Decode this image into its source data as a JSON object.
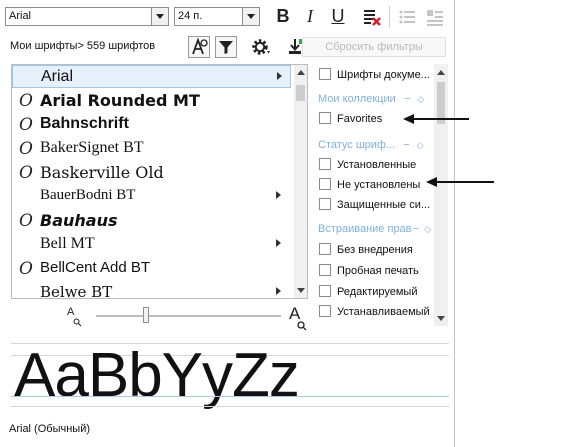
{
  "toolbar": {
    "font_name": "Arial",
    "font_size": "24 п.",
    "bold_label": "B",
    "italic_label": "I",
    "underline_label": "U",
    "icons": [
      "text-color-x-icon",
      "bullet-list-icon",
      "numbered-list-icon"
    ]
  },
  "header": {
    "collection_label": "Мои шрифты> 559 шрифтов",
    "reset_filters": "Сбросить фильтры",
    "icons": [
      "font-playground-icon",
      "filter-icon",
      "gear-icon",
      "download-font-icon"
    ]
  },
  "font_list": {
    "items": [
      {
        "name": "Arial",
        "selected": true,
        "opentype": false,
        "has_submenu": true
      },
      {
        "name": "Arial Rounded MT",
        "selected": false,
        "opentype": true,
        "has_submenu": false
      },
      {
        "name": "Bahnschrift",
        "selected": false,
        "opentype": true,
        "has_submenu": false
      },
      {
        "name": "BakerSignet BT",
        "selected": false,
        "opentype": true,
        "has_submenu": false
      },
      {
        "name": "Baskerville Old",
        "selected": false,
        "opentype": true,
        "has_submenu": false
      },
      {
        "name": "BauerBodni BT",
        "selected": false,
        "opentype": false,
        "has_submenu": true
      },
      {
        "name": "Bauhaus",
        "selected": false,
        "opentype": true,
        "has_submenu": false
      },
      {
        "name": "Bell MT",
        "selected": false,
        "opentype": false,
        "has_submenu": true
      },
      {
        "name": "BellCent Add BT",
        "selected": false,
        "opentype": true,
        "has_submenu": false
      },
      {
        "name": "Belwe BT",
        "selected": false,
        "opentype": false,
        "has_submenu": true
      }
    ]
  },
  "zoom": {
    "small_label": "A",
    "large_label": "A",
    "level": 0.27
  },
  "filters": {
    "top_item": "Шрифты докуме...",
    "my_collections": {
      "heading": "Мои коллекции",
      "items": [
        "Favorites"
      ]
    },
    "font_status": {
      "heading": "Статус шриф...",
      "items": [
        "Установленные",
        "Не установлены",
        "Защищенные си..."
      ]
    },
    "embedding": {
      "heading": "Встраивание прав",
      "items": [
        "Без внедрения",
        "Пробная печать",
        "Редактируемый",
        "Устанавливаемый"
      ]
    },
    "expand_symbols": {
      "minus": "−",
      "diamond": "◇"
    }
  },
  "preview": {
    "sample_text": "AaBbYyZz",
    "status_text": "Arial (Обычный)"
  },
  "colors": {
    "section_heading": "#7fb1df",
    "selection_bg": "#e5f0fb",
    "selection_border": "#9ec6ea",
    "disabled_text": "#b9b9b9",
    "baseline": "#a9c9e8"
  }
}
